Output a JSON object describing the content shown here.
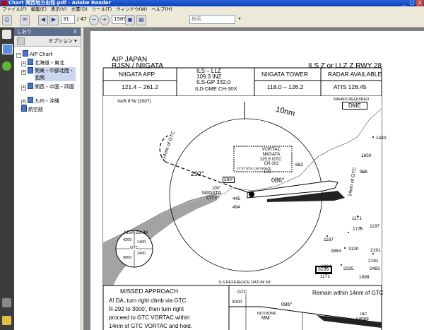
{
  "window": {
    "title": "Chart 関西地方出発.pdf - Adobe Reader",
    "minimize": "_",
    "maximize": "□",
    "close": "X"
  },
  "menu": [
    "ファイル(F)",
    "編集(E)",
    "表示(V)",
    "文書(D)",
    "ツール(T)",
    "ウィンドウ(W)",
    "ヘルプ(H)"
  ],
  "toolbar": {
    "page_current": "31",
    "page_total": "/ 47",
    "zoom": "158%",
    "search_placeholder": "検索"
  },
  "bookmarks": {
    "header": "しおり",
    "close": "X",
    "options": "オプション ▾",
    "root": "AIP Chart",
    "items": [
      "北海道・東北",
      "関東・中部北陸・北関",
      "関西・中国・四国",
      "九州・沖縄"
    ],
    "extra": "航空路"
  },
  "chart": {
    "org": "AIP JAPAN",
    "airport": "RJSN / NIIGATA",
    "procedure": "ILS Z or LLZ Z RWY 28",
    "freq_headers": [
      "NIIGATA APP",
      "NIIGATA TOWER",
      "RADAR AVAILABLE"
    ],
    "app_freq": "121.4 – 261.2",
    "ils_lines": [
      "ILS – LLZ",
      "109.3 INZ",
      "ILS-GP 332.0",
      "ILD-DME CH-30X"
    ],
    "tower_freq": "118.0 – 126.2",
    "atis": "ATIS   128.45",
    "var": "VAR 8°W (2007)",
    "navaid_req": "NAVAID REQUIRED",
    "dme": "DME",
    "ring": "10nm",
    "vortac": [
      "VORTAC",
      "NIIGATA",
      "115.5 GTC",
      "CH-102",
      "37°57'30\"N 139°06'56\"E"
    ],
    "gtc_arc": "14nm of GTC",
    "gtc_arc2": "14nm of GTC",
    "crs292": "292°",
    "crs280a": "280°",
    "crs280b": "280°",
    "crs086": "086°",
    "crs100": "100°",
    "city": [
      "NIIGATA",
      "CITY"
    ],
    "spots": [
      "1440",
      "1850",
      "908",
      "682",
      "179",
      "445",
      "494",
      "1171",
      "1778",
      "1197",
      "1187",
      "2864",
      "3130",
      "2191",
      "2191",
      "1834",
      "2325",
      "2483",
      "1171",
      "1998"
    ],
    "box_elev": "3196",
    "msa_title": "MSA 25NM",
    "msa_values": [
      "4200",
      "1400",
      "2400",
      "9000",
      "GTC"
    ],
    "ils_datum": "ILS REFERENCE DATUM 58'",
    "missed_title": "MISSED APPROACH",
    "missed_text": [
      "A! DA, turn right climb via GTC",
      "R-292 to 3000', then turn right",
      "proceed to GTC VORTAC within",
      "14nm of GTC VORTAC and hold."
    ],
    "remain": "Remain within 14nm of GTC",
    "profile": {
      "gtc": "GTC",
      "alt": "3000",
      "crs": "086°",
      "inc8": "INC0.8DME",
      "mm": "MM",
      "inc": "INC",
      "dme": "0.8DME"
    }
  }
}
